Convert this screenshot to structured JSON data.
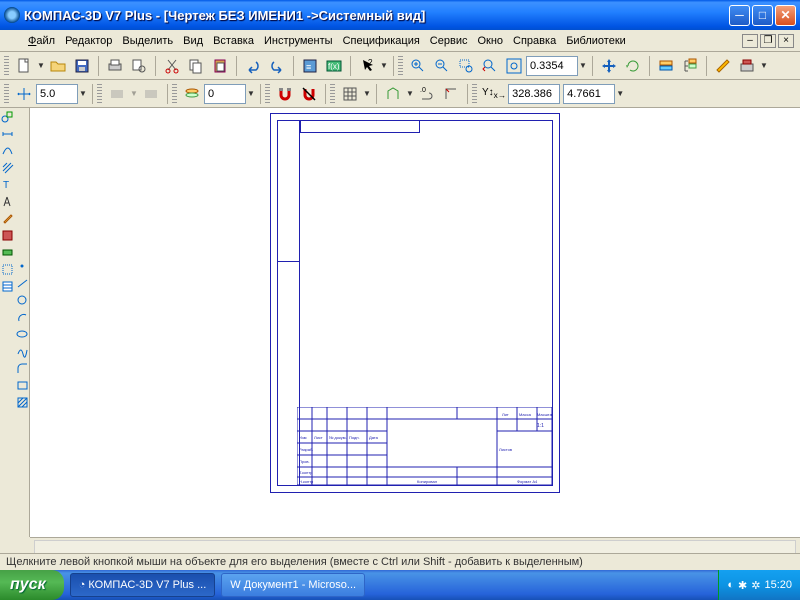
{
  "titlebar": {
    "text": "КОМПАС-3D V7 Plus - [Чертеж БЕЗ ИМЕНИ1 ->Системный вид]"
  },
  "menu": {
    "file": "Файл",
    "edit": "Редактор",
    "select": "Выделить",
    "view": "Вид",
    "insert": "Вставка",
    "tools": "Инструменты",
    "spec": "Спецификация",
    "service": "Сервис",
    "window": "Окно",
    "help": "Справка",
    "libs": "Библиотеки"
  },
  "tb1": {
    "zoom_val": "0.3354"
  },
  "tb2": {
    "step": "5.0",
    "layer": "0",
    "coord_x": "328.386",
    "coord_y": "4.7661"
  },
  "hint": "Щелкните левой кнопкой мыши на объекте для его выделения (вместе с Ctrl или Shift - добавить к выделенным)",
  "taskbar": {
    "start": "пуск",
    "task1": "КОМПАС-3D V7 Plus ...",
    "task2": "Документ1 - Microso...",
    "clock": "15:20"
  }
}
